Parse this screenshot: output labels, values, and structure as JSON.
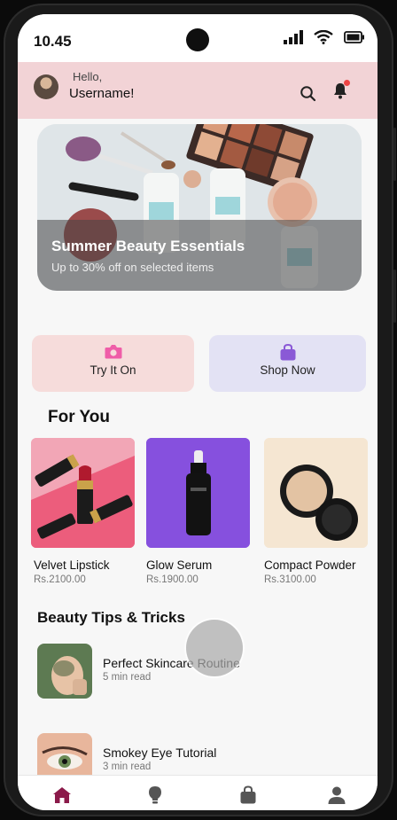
{
  "status_bar": {
    "time": "10.45"
  },
  "header": {
    "greeting": "Hello,",
    "username": "Username!"
  },
  "banner": {
    "title": "Summer Beauty Essentials",
    "subtitle": "Up to 30% off on selected items"
  },
  "actions": [
    {
      "label": "Try It On",
      "icon": "camera-icon",
      "color": "#f6dcdb",
      "icon_color": "#ef5da8"
    },
    {
      "label": "Shop Now",
      "icon": "shopping-bag-icon",
      "color": "#e3e2f4",
      "icon_color": "#8a59d6"
    }
  ],
  "for_you": {
    "title": "For You",
    "products": [
      {
        "name": "Velvet Lipstick",
        "price": "Rs.2100.00"
      },
      {
        "name": "Glow Serum",
        "price": "Rs.1900.00"
      },
      {
        "name": "Compact Powder",
        "price": "Rs.3100.00"
      }
    ]
  },
  "tips": {
    "title": "Beauty Tips & Tricks",
    "items": [
      {
        "title": "Perfect Skincare Routine",
        "read_time": "5 min read"
      },
      {
        "title": "Smokey Eye Tutorial",
        "read_time": "3 min read"
      }
    ]
  },
  "bottom_nav": [
    "home-icon",
    "lightbulb-icon",
    "shopping-bag-icon",
    "user-icon"
  ],
  "colors": {
    "accent": "#8b1a4a",
    "header_bg": "#f2d3d6",
    "nav_icon": "#555555"
  }
}
